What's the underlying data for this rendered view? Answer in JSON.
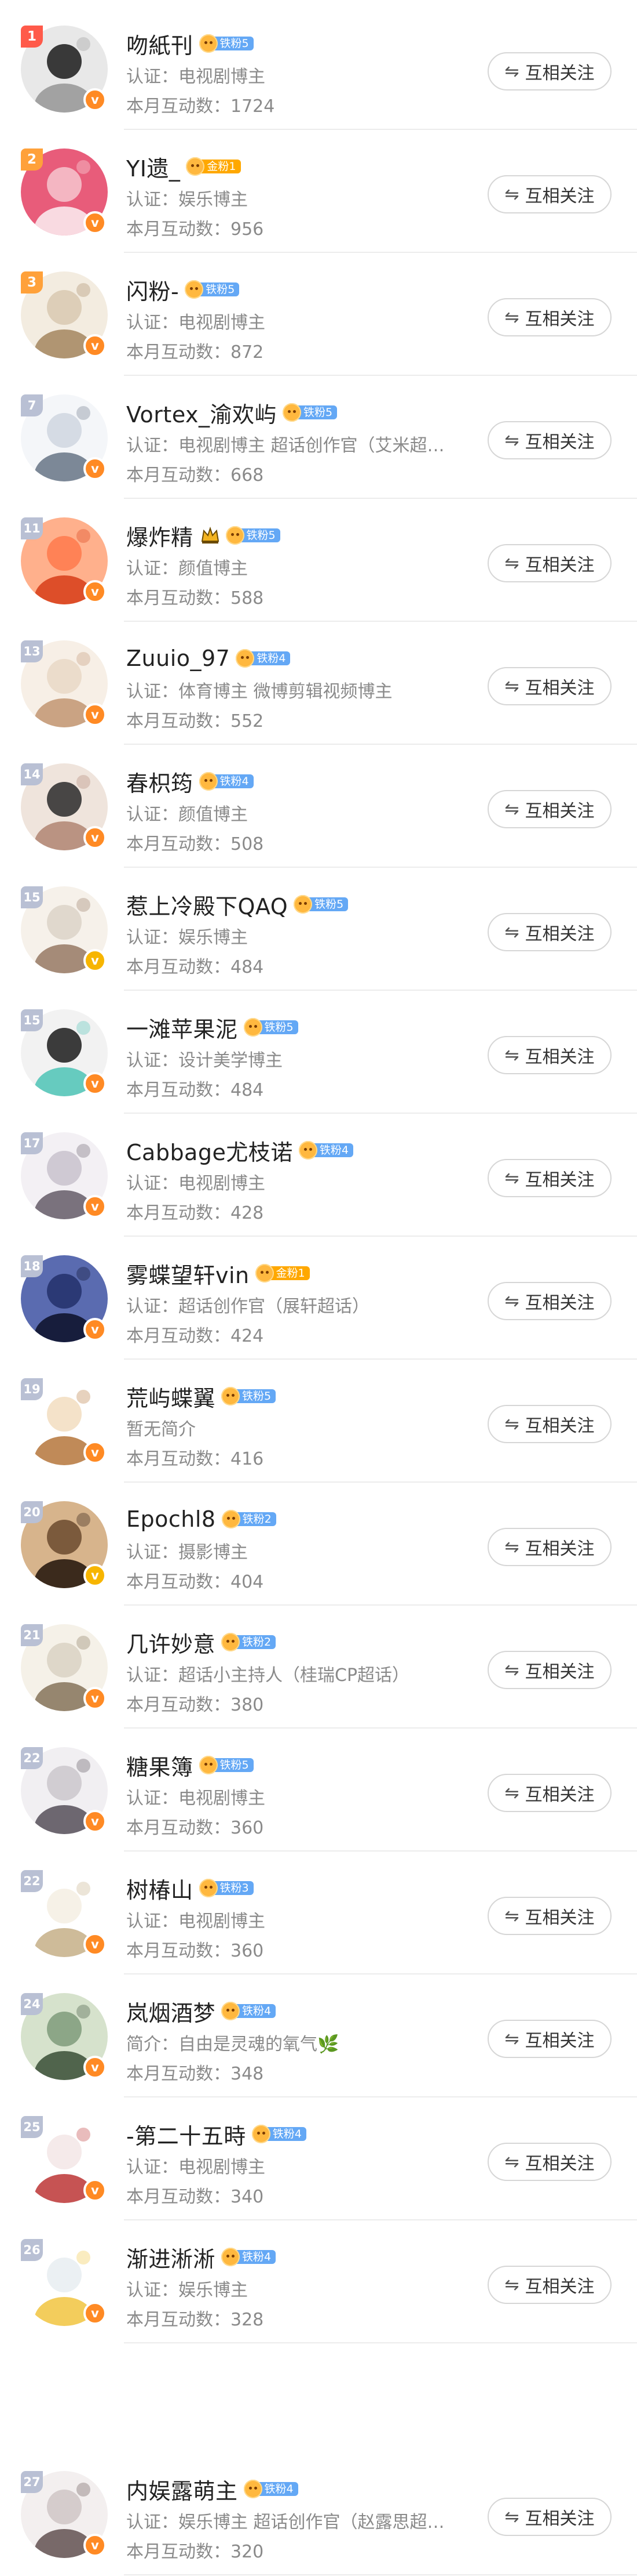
{
  "follow_label": "互相关注",
  "follow_icon": "swap-arrows-icon",
  "colors": {
    "rank_top": "#ff5a4a",
    "rank_mid": "#ffa13a",
    "rank_low": "#b9c0d4",
    "verified": "#ff8a24",
    "fan_blue": "#64a8f5",
    "fan_gold": "#ffa800",
    "text_secondary": "#8a8a8a"
  },
  "users": [
    {
      "rank": "1",
      "name": "吻紙刊",
      "crown": false,
      "fan_level": "铁粉5",
      "fan_tier": "blue",
      "desc": "认证：电视剧博主",
      "stat": "本月互动数：1724",
      "verify": "orange"
    },
    {
      "rank": "2",
      "name": "YI遗_",
      "crown": false,
      "fan_level": "金粉1",
      "fan_tier": "gold",
      "desc": "认证：娱乐博主",
      "stat": "本月互动数：956",
      "verify": "orange"
    },
    {
      "rank": "3",
      "name": "闪粉-",
      "crown": false,
      "fan_level": "铁粉5",
      "fan_tier": "blue",
      "desc": "认证：电视剧博主",
      "stat": "本月互动数：872",
      "verify": "orange"
    },
    {
      "rank": "7",
      "name": "Vortex_渝欢屿",
      "crown": false,
      "fan_level": "铁粉5",
      "fan_tier": "blue",
      "desc": "认证：电视剧博主 超话创作官（艾米超…",
      "stat": "本月互动数：668",
      "verify": "orange"
    },
    {
      "rank": "11",
      "name": "爆炸精",
      "crown": true,
      "fan_level": "铁粉5",
      "fan_tier": "blue",
      "desc": "认证：颜值博主",
      "stat": "本月互动数：588",
      "verify": "orange"
    },
    {
      "rank": "13",
      "name": "Zuuio_97",
      "crown": false,
      "fan_level": "铁粉4",
      "fan_tier": "blue",
      "desc": "认证：体育博主 微博剪辑视频博主",
      "stat": "本月互动数：552",
      "verify": "orange"
    },
    {
      "rank": "14",
      "name": "春枳筠",
      "crown": false,
      "fan_level": "铁粉4",
      "fan_tier": "blue",
      "desc": "认证：颜值博主",
      "stat": "本月互动数：508",
      "verify": "orange"
    },
    {
      "rank": "15",
      "name": "惹上冷殿下QAQ",
      "crown": false,
      "fan_level": "铁粉5",
      "fan_tier": "blue",
      "desc": "认证：娱乐博主",
      "stat": "本月互动数：484",
      "verify": "yellow"
    },
    {
      "rank": "15",
      "name": "一滩苹果泥",
      "crown": false,
      "fan_level": "铁粉5",
      "fan_tier": "blue",
      "desc": "认证：设计美学博主",
      "stat": "本月互动数：484",
      "verify": "orange"
    },
    {
      "rank": "17",
      "name": "Cabbage尤枝诺",
      "crown": false,
      "fan_level": "铁粉4",
      "fan_tier": "blue",
      "desc": "认证：电视剧博主",
      "stat": "本月互动数：428",
      "verify": "orange"
    },
    {
      "rank": "18",
      "name": "雾蝶望轩vin",
      "crown": false,
      "fan_level": "金粉1",
      "fan_tier": "gold",
      "desc": "认证：超话创作官（展轩超话）",
      "stat": "本月互动数：424",
      "verify": "orange"
    },
    {
      "rank": "19",
      "name": "荒屿蝶翼",
      "crown": false,
      "fan_level": "铁粉5",
      "fan_tier": "blue",
      "desc": "暂无简介",
      "stat": "本月互动数：416",
      "verify": "orange"
    },
    {
      "rank": "20",
      "name": "Epochl8",
      "crown": false,
      "fan_level": "铁粉2",
      "fan_tier": "blue",
      "desc": "认证：摄影博主",
      "stat": "本月互动数：404",
      "verify": "yellow"
    },
    {
      "rank": "21",
      "name": "几许妙意",
      "crown": false,
      "fan_level": "铁粉2",
      "fan_tier": "blue",
      "desc": "认证：超话小主持人（桂瑞CP超话）",
      "stat": "本月互动数：380",
      "verify": "orange"
    },
    {
      "rank": "22",
      "name": "糖果簿",
      "crown": false,
      "fan_level": "铁粉5",
      "fan_tier": "blue",
      "desc": "认证：电视剧博主",
      "stat": "本月互动数：360",
      "verify": "orange"
    },
    {
      "rank": "22",
      "name": "树椿山",
      "crown": false,
      "fan_level": "铁粉3",
      "fan_tier": "blue",
      "desc": "认证：电视剧博主",
      "stat": "本月互动数：360",
      "verify": "orange"
    },
    {
      "rank": "24",
      "name": "岚烟酒梦",
      "crown": false,
      "fan_level": "铁粉4",
      "fan_tier": "blue",
      "desc": "简介：自由是灵魂的氧气🌿",
      "stat": "本月互动数：348",
      "verify": "orange"
    },
    {
      "rank": "25",
      "name": "-第二十五時",
      "crown": false,
      "fan_level": "铁粉4",
      "fan_tier": "blue",
      "desc": "认证：电视剧博主",
      "stat": "本月互动数：340",
      "verify": "orange"
    },
    {
      "rank": "26",
      "name": "渐进淅淅",
      "crown": false,
      "fan_level": "铁粉4",
      "fan_tier": "blue",
      "desc": "认证：娱乐博主",
      "stat": "本月互动数：328",
      "verify": "orange"
    },
    {
      "rank": "27",
      "name": "内娱露萌主",
      "crown": false,
      "fan_level": "铁粉4",
      "fan_tier": "blue",
      "desc": "认证：娱乐博主 超话创作官（赵露思超…",
      "stat": "本月互动数：320",
      "verify": "orange"
    }
  ]
}
